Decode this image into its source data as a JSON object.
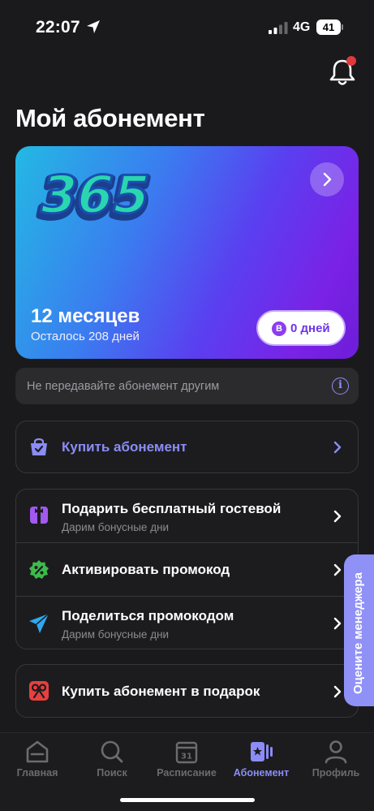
{
  "status_bar": {
    "time": "22:07",
    "network": "4G",
    "battery": "41"
  },
  "header": {
    "title": "Мой абонемент",
    "bell_icon": "bell-icon"
  },
  "card": {
    "logo_text": "365",
    "period": "12 месяцев",
    "remaining": "Осталось 208 дней",
    "bonus_coin": "B",
    "bonus_days": "0 дней",
    "colors": {
      "gradient_start": "#23b9e3",
      "gradient_end": "#6d1dd9"
    }
  },
  "info": {
    "text": "Не передавайте абонемент другим",
    "icon": "info-icon"
  },
  "buy": {
    "label": "Купить абонемент",
    "icon": "shopping-bag-icon",
    "color": "#8b8cf5"
  },
  "actions": [
    {
      "label": "Подарить бесплатный гостевой",
      "sub": "Дарим бонусные дни",
      "icon": "gift-icon"
    },
    {
      "label": "Активировать промокод",
      "sub": "",
      "icon": "percent-badge-icon"
    },
    {
      "label": "Поделиться промокодом",
      "sub": "Дарим бонусные дни",
      "icon": "send-icon"
    }
  ],
  "gift_buy": {
    "label": "Купить абонемент в подарок",
    "icon": "gift-bow-icon"
  },
  "manager_tab": {
    "label": "Оцените менеджера"
  },
  "nav": [
    {
      "label": "Главная",
      "icon": "home-icon",
      "active": false
    },
    {
      "label": "Поиск",
      "icon": "search-icon",
      "active": false
    },
    {
      "label": "Расписание",
      "icon": "calendar-icon",
      "calendar_day": "31",
      "active": false
    },
    {
      "label": "Абонемент",
      "icon": "membership-card-icon",
      "active": true
    },
    {
      "label": "Профиль",
      "icon": "profile-icon",
      "active": false
    }
  ],
  "accent_color": "#8b8cf5"
}
